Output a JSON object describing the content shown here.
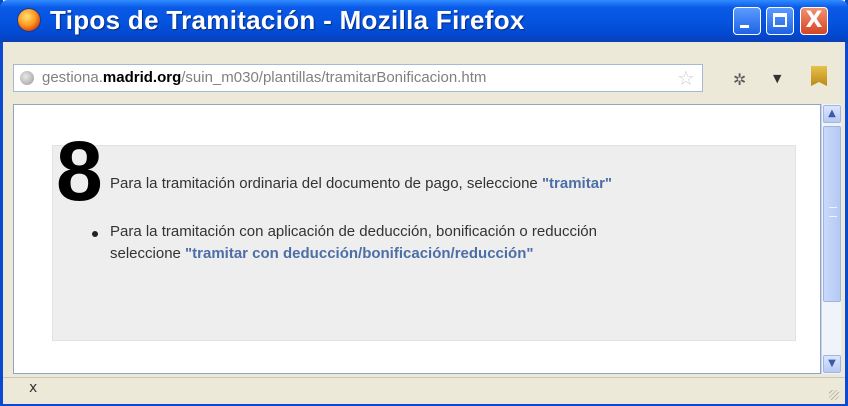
{
  "window": {
    "title": "Tipos de Tramitación - Mozilla Firefox",
    "controls": {
      "minimize_icon": "minimize-icon",
      "maximize_icon": "maximize-icon",
      "close_label": "X"
    }
  },
  "address_bar": {
    "url_prefix": "gestiona.",
    "url_domain": "madrid.org",
    "url_path": "/suin_m030/plantillas/tramitarBonificacion.htm"
  },
  "content": {
    "step_number": "8",
    "line1_text": "Para la tramitación ordinaria del documento de pago, seleccione ",
    "line1_link": "\"tramitar\"",
    "bullet_line1": "Para la tramitación con aplicación de deducción, bonificación o reducción",
    "bullet_line2_text": "seleccione ",
    "bullet_line2_link": "\"tramitar con deducción/bonificación/reducción\""
  },
  "status_bar": {
    "text": "x"
  },
  "colors": {
    "title_bar": "#0554e0",
    "link": "#4d6ea6",
    "panel_bg": "#eeeeee"
  }
}
